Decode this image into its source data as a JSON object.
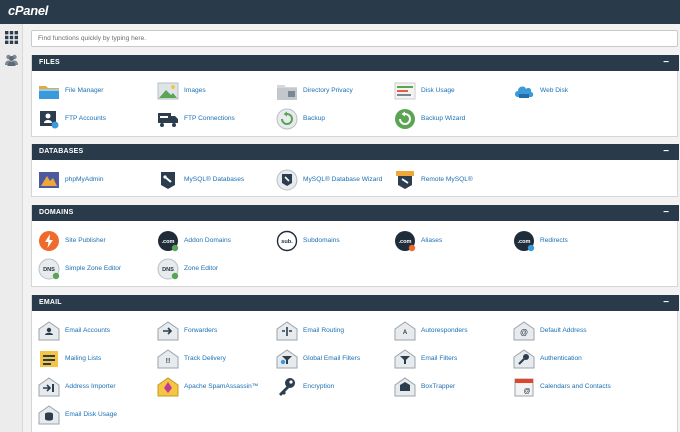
{
  "app": {
    "logo": "cPanel"
  },
  "search": {
    "placeholder": "Find functions quickly by typing here."
  },
  "colors": {
    "header": "#293a4a",
    "link": "#1b6fb3"
  },
  "sections": [
    {
      "title": "FILES",
      "collapse": "−",
      "items": [
        {
          "label": "File Manager",
          "icon": "folder-icon"
        },
        {
          "label": "Images",
          "icon": "image-icon"
        },
        {
          "label": "Directory Privacy",
          "icon": "folder-lock-icon"
        },
        {
          "label": "Disk Usage",
          "icon": "disk-usage-icon"
        },
        {
          "label": "Web Disk",
          "icon": "cloud-icon"
        },
        {
          "label": "FTP Accounts",
          "icon": "ftp-user-icon"
        },
        {
          "label": "FTP Connections",
          "icon": "ftp-truck-icon"
        },
        {
          "label": "Backup",
          "icon": "backup-icon"
        },
        {
          "label": "Backup Wizard",
          "icon": "backup-wizard-icon"
        }
      ]
    },
    {
      "title": "DATABASES",
      "collapse": "−",
      "items": [
        {
          "label": "phpMyAdmin",
          "icon": "phpmyadmin-icon"
        },
        {
          "label": "MySQL® Databases",
          "icon": "mysql-icon"
        },
        {
          "label": "MySQL® Database Wizard",
          "icon": "mysql-wizard-icon"
        },
        {
          "label": "Remote MySQL®",
          "icon": "remote-mysql-icon"
        }
      ]
    },
    {
      "title": "DOMAINS",
      "collapse": "−",
      "items": [
        {
          "label": "Site Publisher",
          "icon": "lightning-icon"
        },
        {
          "label": "Addon Domains",
          "icon": "addon-domain-icon"
        },
        {
          "label": "Subdomains",
          "icon": "subdomain-icon"
        },
        {
          "label": "Aliases",
          "icon": "alias-icon"
        },
        {
          "label": "Redirects",
          "icon": "redirect-icon"
        },
        {
          "label": "Simple Zone Editor",
          "icon": "dns-simple-icon"
        },
        {
          "label": "Zone Editor",
          "icon": "dns-zone-icon"
        }
      ]
    },
    {
      "title": "EMAIL",
      "collapse": "−",
      "items": [
        {
          "label": "Email Accounts",
          "icon": "email-account-icon"
        },
        {
          "label": "Forwarders",
          "icon": "forwarder-icon"
        },
        {
          "label": "Email Routing",
          "icon": "email-routing-icon"
        },
        {
          "label": "Autoresponders",
          "icon": "autoresponder-icon"
        },
        {
          "label": "Default Address",
          "icon": "default-address-icon"
        },
        {
          "label": "Mailing Lists",
          "icon": "mailing-list-icon"
        },
        {
          "label": "Track Delivery",
          "icon": "track-delivery-icon"
        },
        {
          "label": "Global Email Filters",
          "icon": "global-filter-icon"
        },
        {
          "label": "Email Filters",
          "icon": "email-filter-icon"
        },
        {
          "label": "Authentication",
          "icon": "key-icon"
        },
        {
          "label": "Address Importer",
          "icon": "address-importer-icon"
        },
        {
          "label": "Apache SpamAssassin™",
          "icon": "spam-icon"
        },
        {
          "label": "Encryption",
          "icon": "encryption-key-icon"
        },
        {
          "label": "BoxTrapper",
          "icon": "boxtrapper-icon"
        },
        {
          "label": "Calendars and Contacts",
          "icon": "calendar-icon"
        },
        {
          "label": "Email Disk Usage",
          "icon": "email-disk-icon"
        }
      ]
    }
  ]
}
